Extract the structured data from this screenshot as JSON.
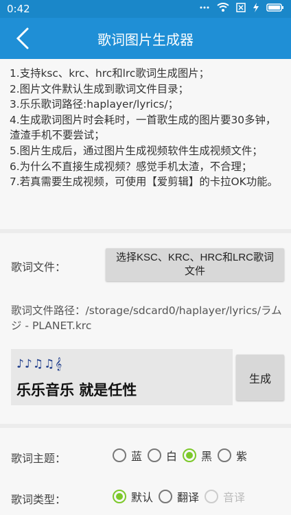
{
  "status": {
    "time": "0:42"
  },
  "appbar": {
    "title": "歌词图片生成器"
  },
  "info_lines": [
    "1.支持ksc、krc、hrc和lrc歌词生成图片；",
    "2.图片文件默认生成到歌词文件目录；",
    "3.乐乐歌词路径:haplayer/lyrics/；",
    "4.生成歌词图片时会耗时，一首歌生成的图片要30多钟，渣渣手机不要尝试；",
    "5.图片生成后，通过图片生成视频软件生成视频文件；",
    "6.为什么不直接生成视频？感觉手机太渣，不合理；",
    "7.若真需要生成视频，可使用【爱剪辑】的卡拉OK功能。"
  ],
  "lyrics_file": {
    "label": "歌词文件：",
    "select_button": "选择KSC、KRC、HRC和LRC歌词文件",
    "path_label": "歌词文件路径：",
    "path_value": "/storage/sdcard0/haplayer/lyrics/ラムジ - PLANET.krc"
  },
  "preview": {
    "notes": "♪♪♫♫𝄞",
    "text": "乐乐音乐 就是任性"
  },
  "generate_button": "生成",
  "theme": {
    "label": "歌词主题：",
    "options": [
      {
        "label": "蓝",
        "checked": false
      },
      {
        "label": "白",
        "checked": false
      },
      {
        "label": "黑",
        "checked": true
      },
      {
        "label": "紫",
        "checked": false
      }
    ]
  },
  "type": {
    "label": "歌词类型：",
    "options": [
      {
        "label": "默认",
        "checked": true,
        "disabled": false
      },
      {
        "label": "翻译",
        "checked": false,
        "disabled": false
      },
      {
        "label": "音译",
        "checked": false,
        "disabled": true
      }
    ]
  },
  "colors": {
    "primary": "#1f8fd6",
    "accent": "#7cc82a"
  }
}
